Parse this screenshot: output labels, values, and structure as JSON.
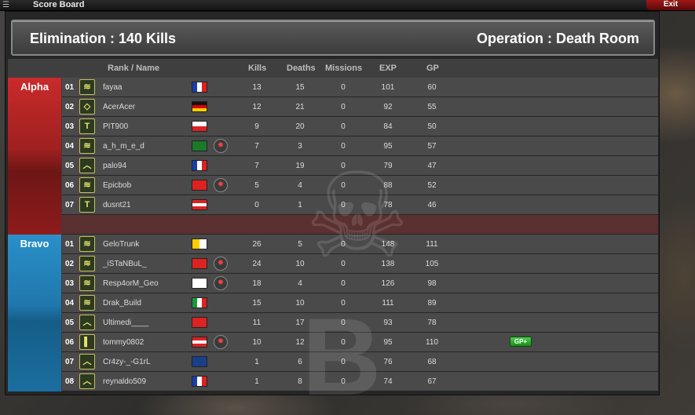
{
  "window": {
    "title": "Score Board",
    "exit_label": "Exit"
  },
  "header": {
    "mode": "Elimination : 140 Kills",
    "operation": "Operation : Death Room"
  },
  "columns": {
    "rank_name": "Rank / Name",
    "kills": "Kills",
    "deaths": "Deaths",
    "missions": "Missions",
    "exp": "EXP",
    "gp": "GP"
  },
  "teams": {
    "alpha": {
      "name": "Alpha",
      "color": "#c92a2a",
      "players": [
        {
          "num": "01",
          "name": "fayaa",
          "flag": "france-flag",
          "kills": "13",
          "deaths": "15",
          "missions": "0",
          "exp": "101",
          "gp": "60"
        },
        {
          "num": "02",
          "name": "AcerAcer",
          "flag": "germany-flag",
          "kills": "12",
          "deaths": "21",
          "missions": "0",
          "exp": "92",
          "gp": "55"
        },
        {
          "num": "03",
          "name": "PIT900",
          "flag": "poland-flag",
          "kills": "9",
          "deaths": "20",
          "missions": "0",
          "exp": "84",
          "gp": "50"
        },
        {
          "num": "04",
          "name": "a_h_m_e_d",
          "flag": "saudi-arabia-flag",
          "kills": "7",
          "deaths": "3",
          "missions": "0",
          "exp": "95",
          "gp": "57"
        },
        {
          "num": "05",
          "name": "palo94",
          "flag": "france-flag",
          "kills": "7",
          "deaths": "19",
          "missions": "0",
          "exp": "79",
          "gp": "47"
        },
        {
          "num": "06",
          "name": "Epicbob",
          "flag": "switzerland-flag",
          "kills": "5",
          "deaths": "4",
          "missions": "0",
          "exp": "88",
          "gp": "52"
        },
        {
          "num": "07",
          "name": "dusnt21",
          "flag": "austria-flag",
          "kills": "0",
          "deaths": "1",
          "missions": "0",
          "exp": "78",
          "gp": "46"
        }
      ]
    },
    "bravo": {
      "name": "Bravo",
      "color": "#2a8fc9",
      "players": [
        {
          "num": "01",
          "name": "GeloTrunk",
          "flag": "vatican-flag",
          "kills": "26",
          "deaths": "5",
          "missions": "0",
          "exp": "148",
          "gp": "111"
        },
        {
          "num": "02",
          "name": "_iSTaNBuL_",
          "flag": "turkey-flag",
          "kills": "24",
          "deaths": "10",
          "missions": "0",
          "exp": "138",
          "gp": "105"
        },
        {
          "num": "03",
          "name": "Resp4orM_Geo",
          "flag": "georgia-flag",
          "kills": "18",
          "deaths": "4",
          "missions": "0",
          "exp": "126",
          "gp": "98"
        },
        {
          "num": "04",
          "name": "Drak_Build",
          "flag": "italy-flag",
          "kills": "15",
          "deaths": "10",
          "missions": "0",
          "exp": "111",
          "gp": "89"
        },
        {
          "num": "05",
          "name": "Ultimedi____",
          "flag": "albania-flag",
          "kills": "11",
          "deaths": "17",
          "missions": "0",
          "exp": "93",
          "gp": "78"
        },
        {
          "num": "06",
          "name": "tommy0802",
          "flag": "austria-flag",
          "kills": "10",
          "deaths": "12",
          "missions": "0",
          "exp": "95",
          "gp": "110"
        },
        {
          "num": "07",
          "name": "Cr4zy-_-G1rL",
          "flag": "uk-flag",
          "kills": "1",
          "deaths": "6",
          "missions": "0",
          "exp": "76",
          "gp": "68"
        },
        {
          "num": "08",
          "name": "reynaldo509",
          "flag": "france-flag",
          "kills": "1",
          "deaths": "8",
          "missions": "0",
          "exp": "74",
          "gp": "67"
        }
      ]
    }
  },
  "gp_bonus_label": "GP+"
}
